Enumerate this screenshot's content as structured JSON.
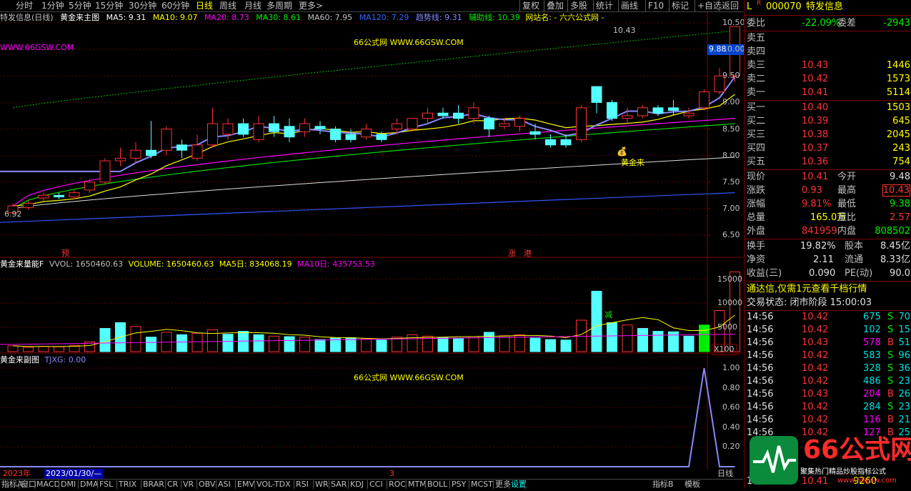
{
  "topbar": {
    "periods": [
      "分时",
      "1分钟",
      "5分钟",
      "15分钟",
      "30分钟",
      "60分钟",
      "日线",
      "周线",
      "月线",
      "多周期",
      "更多>"
    ],
    "active": "日线",
    "right_items": [
      "复权",
      "叠加",
      "多股",
      "统计",
      "画线",
      "F10",
      "标记",
      "+自选",
      "返回"
    ]
  },
  "main_header": {
    "stock": "特发信息(日线)",
    "indicator": "黄金来主图",
    "ma5": "MA5: 9.31",
    "ma10": "MA10: 9.07",
    "ma20": "MA20: 8.73",
    "ma30": "MA30: 8.61",
    "ma60": "MA60: 7.95",
    "ma120": "MA120: 7.29",
    "trend": "趋势线: 9.31",
    "assist": "辅助线: 10.39",
    "site_label": "网站名: - 六六公式网 -"
  },
  "watermark_url": "WWW.66GSW.COM",
  "watermark_center": "66公式网 WWW.66GSW.COM",
  "main_annotations": {
    "high_label": "10.43",
    "low_label": "6.92",
    "golden_label": "黄金来",
    "signal_yu": "预",
    "signal_zhang": "涨",
    "signal_gang": "港",
    "current_price_tag": "9.88"
  },
  "main_yaxis": [
    "10.50",
    "10.00",
    "9.50",
    "9.00",
    "8.50",
    "8.00",
    "7.50",
    "7.00",
    "6.50"
  ],
  "volume_header": {
    "indicator": "黄金来量能F",
    "vvol": "VVOL: 1650460.63",
    "volume": "VOLUME: 1650460.63",
    "ma5": "MA5日: 834068.19",
    "ma10": "MA10日: 435753.53"
  },
  "volume_yaxis": [
    "15000",
    "10000",
    "5000"
  ],
  "volume_unit": "X100",
  "volume_signal": "减",
  "sub_header": {
    "indicator": "黄金来副图",
    "tjxg": "TJXG: 0.00"
  },
  "sub_yaxis": [
    "1.00",
    "0.80",
    "0.60",
    "0.40",
    "0.20"
  ],
  "yearbar": {
    "year": "2023年",
    "date": "2023/01/30/—",
    "mark": "3",
    "period": "日线"
  },
  "bottombar": [
    "指标A",
    "窗口",
    "MACD",
    "DMI",
    "DMA",
    "FSL",
    "TRIX",
    "BRAR",
    "CR",
    "VR",
    "OBV",
    "ASI",
    "EMV",
    "VOL-TDX",
    "RSI",
    "WR",
    "SAR",
    "KDJ",
    "CCI",
    "ROC",
    "MTM",
    "BOLL",
    "PSY",
    "MCST",
    "更多",
    "设置"
  ],
  "bottombar_right": [
    "指标B",
    "模板"
  ],
  "quote": {
    "badge_l": "L",
    "badge_r": "R",
    "code": "000070",
    "name": "特发信息",
    "weibi_label": "委比",
    "weibi": "-22.09%",
    "weicha_label": "委差",
    "weicha": "-2943",
    "asks": [
      {
        "label": "卖五",
        "price": "",
        "vol": ""
      },
      {
        "label": "卖四",
        "price": "",
        "vol": ""
      },
      {
        "label": "卖三",
        "price": "10.43",
        "vol": "1446"
      },
      {
        "label": "卖二",
        "price": "10.42",
        "vol": "1573"
      },
      {
        "label": "卖一",
        "price": "10.41",
        "vol": "5114"
      }
    ],
    "bids": [
      {
        "label": "买一",
        "price": "10.40",
        "vol": "1503"
      },
      {
        "label": "买二",
        "price": "10.39",
        "vol": "645"
      },
      {
        "label": "买三",
        "price": "10.38",
        "vol": "2045"
      },
      {
        "label": "买四",
        "price": "10.37",
        "vol": "243"
      },
      {
        "label": "买五",
        "price": "10.36",
        "vol": "754"
      }
    ],
    "stats": [
      {
        "l1": "现价",
        "v1": "10.41",
        "l2": "今开",
        "v2": "9.48"
      },
      {
        "l1": "涨跌",
        "v1": "0.93",
        "l2": "最高",
        "v2": "10.43"
      },
      {
        "l1": "涨幅",
        "v1": "9.81%",
        "l2": "最低",
        "v2": "9.38"
      },
      {
        "l1": "总量",
        "v1": "165.0万",
        "l2": "量比",
        "v2": "2.57"
      },
      {
        "l1": "外盘",
        "v1": "841959",
        "l2": "内盘",
        "v2": "808502"
      }
    ],
    "stats2": [
      {
        "l1": "换手",
        "v1": "19.82%",
        "l2": "股本",
        "v2": "8.45亿"
      },
      {
        "l1": "净资",
        "v1": "2.11",
        "l2": "流通",
        "v2": "8.33亿"
      },
      {
        "l1": "收益(三)",
        "v1": "0.090",
        "l2": "PE(动)",
        "v2": "90.0"
      }
    ],
    "notice": "通达信,仅需1元查看千档行情",
    "status": "交易状态: 闭市阶段 15:00:03",
    "ticks": [
      {
        "t": "14:56",
        "p": "10.42",
        "v": "675",
        "s": "S",
        "n": "70"
      },
      {
        "t": "14:56",
        "p": "10.42",
        "v": "102",
        "s": "S",
        "n": "15"
      },
      {
        "t": "14:56",
        "p": "10.43",
        "v": "578",
        "s": "B",
        "n": "51"
      },
      {
        "t": "14:56",
        "p": "10.42",
        "v": "583",
        "s": "S",
        "n": "96"
      },
      {
        "t": "14:56",
        "p": "10.42",
        "v": "328",
        "s": "S",
        "n": "36"
      },
      {
        "t": "14:56",
        "p": "10.42",
        "v": "486",
        "s": "S",
        "n": "23"
      },
      {
        "t": "14:56",
        "p": "10.43",
        "v": "204",
        "s": "B",
        "n": "26"
      },
      {
        "t": "14:56",
        "p": "10.42",
        "v": "284",
        "s": "S",
        "n": "23"
      },
      {
        "t": "14:56",
        "p": "10.42",
        "v": "116",
        "s": "B",
        "n": "21"
      },
      {
        "t": "14:56",
        "p": "10.42",
        "v": "127",
        "s": "B",
        "n": "25"
      }
    ],
    "last_tick": {
      "t": "15:00",
      "p": "10.41",
      "v": "9260"
    }
  },
  "logo": {
    "brand": "66公式网",
    "slogan": "聚集热门精品炒股指标公式",
    "url": "www.66gsw.com"
  },
  "chart_data": {
    "type": "candlestick",
    "title": "特发信息(日线)",
    "ylim": [
      6.5,
      10.5
    ],
    "candles": [
      [
        6.92,
        7.05,
        6.9,
        7.1
      ],
      [
        7.02,
        7.1,
        6.98,
        7.15
      ],
      [
        7.2,
        7.25,
        7.15,
        7.3
      ],
      [
        7.25,
        7.22,
        7.18,
        7.3
      ],
      [
        7.22,
        7.3,
        7.18,
        7.35
      ],
      [
        7.35,
        7.5,
        7.3,
        7.55
      ],
      [
        7.5,
        7.9,
        7.45,
        7.95
      ],
      [
        7.9,
        7.95,
        7.8,
        8.15
      ],
      [
        7.95,
        8.1,
        7.85,
        8.25
      ],
      [
        8.1,
        8.0,
        7.95,
        8.65
      ],
      [
        8.1,
        8.5,
        8.0,
        8.55
      ],
      [
        8.2,
        8.1,
        7.95,
        8.3
      ],
      [
        7.95,
        8.2,
        7.9,
        8.4
      ],
      [
        8.2,
        8.6,
        8.15,
        8.9
      ],
      [
        8.4,
        8.6,
        8.3,
        8.7
      ],
      [
        8.6,
        8.4,
        8.35,
        8.7
      ],
      [
        8.3,
        8.6,
        8.25,
        8.75
      ],
      [
        8.6,
        8.45,
        8.35,
        8.75
      ],
      [
        8.55,
        8.35,
        8.25,
        8.7
      ],
      [
        8.45,
        8.6,
        8.35,
        8.7
      ],
      [
        8.55,
        8.5,
        8.4,
        8.65
      ],
      [
        8.5,
        8.3,
        8.25,
        8.55
      ],
      [
        8.4,
        8.3,
        8.25,
        8.5
      ],
      [
        8.35,
        8.5,
        8.3,
        8.6
      ],
      [
        8.4,
        8.3,
        8.25,
        8.45
      ],
      [
        8.5,
        8.6,
        8.4,
        8.7
      ],
      [
        8.5,
        8.7,
        8.45,
        8.7
      ],
      [
        8.7,
        8.8,
        8.6,
        8.9
      ],
      [
        8.8,
        8.75,
        8.7,
        8.9
      ],
      [
        8.8,
        8.7,
        8.6,
        8.95
      ],
      [
        8.7,
        8.9,
        8.6,
        9.0
      ],
      [
        8.7,
        8.5,
        8.35,
        8.75
      ],
      [
        8.55,
        8.6,
        8.5,
        8.7
      ],
      [
        8.55,
        8.7,
        8.45,
        8.75
      ],
      [
        8.45,
        8.4,
        8.3,
        8.6
      ],
      [
        8.3,
        8.2,
        8.15,
        8.4
      ],
      [
        8.3,
        8.2,
        8.15,
        8.4
      ],
      [
        8.3,
        8.9,
        8.25,
        8.95
      ],
      [
        9.3,
        9.0,
        8.8,
        9.3
      ],
      [
        9.0,
        8.7,
        8.65,
        9.05
      ],
      [
        8.7,
        8.75,
        8.6,
        8.9
      ],
      [
        8.75,
        8.9,
        8.7,
        8.95
      ],
      [
        8.9,
        8.8,
        8.75,
        8.95
      ],
      [
        8.9,
        8.85,
        8.75,
        9.05
      ],
      [
        8.75,
        8.8,
        8.7,
        8.9
      ],
      [
        8.9,
        9.2,
        8.85,
        9.25
      ],
      [
        9.2,
        9.5,
        9.15,
        9.65
      ],
      [
        9.5,
        10.43,
        9.38,
        10.43
      ]
    ],
    "volume": [
      1200,
      900,
      1100,
      1000,
      1300,
      2000,
      4800,
      6000,
      5200,
      3000,
      4000,
      3500,
      3800,
      4500,
      3600,
      4200,
      3500,
      3200,
      3100,
      3000,
      2500,
      2800,
      2900,
      2600,
      2400,
      3000,
      3500,
      3200,
      2900,
      2800,
      3100,
      4000,
      3300,
      3500,
      2800,
      2500,
      2400,
      6500,
      12500,
      6000,
      5500,
      4800,
      4200,
      4100,
      3200,
      5500,
      8500,
      16500
    ],
    "vol_up": [
      true,
      true,
      true,
      true,
      true,
      true,
      false,
      false,
      true,
      false,
      true,
      false,
      true,
      true,
      false,
      false,
      false,
      true,
      false,
      true,
      false,
      false,
      false,
      true,
      false,
      true,
      true,
      true,
      false,
      false,
      true,
      false,
      true,
      true,
      false,
      false,
      false,
      true,
      false,
      false,
      true,
      false,
      false,
      false,
      false,
      true,
      true,
      true
    ],
    "sub_signal": [
      0,
      0,
      0,
      0,
      0,
      0,
      0,
      0,
      0,
      0,
      0,
      0,
      0,
      0,
      0,
      0,
      0,
      0,
      0,
      0,
      0,
      0,
      0,
      0,
      0,
      0,
      0,
      0,
      0,
      0,
      0,
      0,
      0,
      0,
      0,
      0,
      0,
      0,
      0,
      0,
      0,
      0,
      0,
      0,
      0,
      1,
      0,
      0
    ]
  }
}
